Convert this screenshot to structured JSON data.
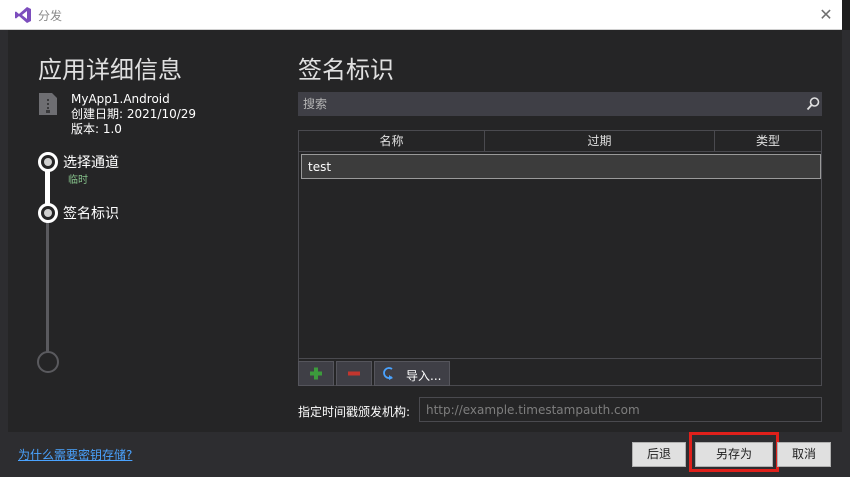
{
  "titlebar": {
    "title": "分发",
    "close_glyph": "✕"
  },
  "left": {
    "title": "应用详细信息",
    "app_name": "MyApp1.Android",
    "app_created": "创建日期: 2021/10/29",
    "app_version": "版本: 1.0",
    "steps": [
      {
        "label": "选择通道",
        "sub": "临时"
      },
      {
        "label": "签名标识"
      }
    ]
  },
  "right": {
    "title": "签名标识",
    "search_placeholder": "搜索",
    "columns": [
      "名称",
      "过期",
      "类型"
    ],
    "rows": [
      {
        "name": "test"
      }
    ],
    "import_label": "导入...",
    "tsa_label": "指定时间戳颁发机构:",
    "tsa_placeholder": "http://example.timestampauth.com"
  },
  "footer": {
    "help_link": "为什么需要密钥存储?",
    "back_label": "后退",
    "save_label": "另存为",
    "cancel_label": "取消"
  },
  "colors": {
    "accent_green": "#3c9b3c",
    "accent_red": "#c3362e",
    "highlight_box": "#e0201b",
    "link": "#4aa3ff"
  },
  "icons": [
    "vs-logo-icon",
    "close-icon",
    "android-app-icon",
    "search-icon",
    "plus-icon",
    "minus-icon",
    "import-icon"
  ]
}
